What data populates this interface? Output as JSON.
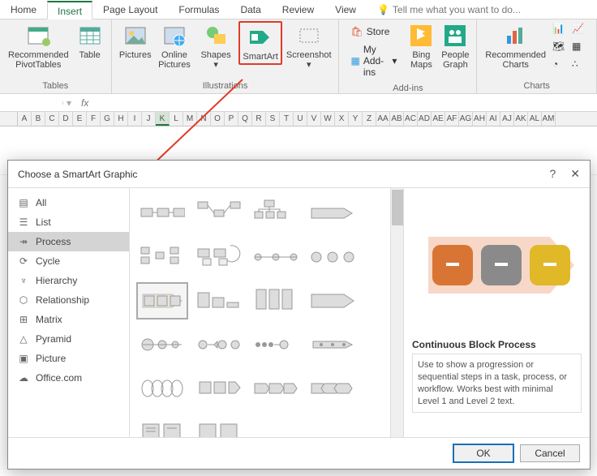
{
  "tabs": {
    "home": "Home",
    "insert": "Insert",
    "page_layout": "Page Layout",
    "formulas": "Formulas",
    "data": "Data",
    "review": "Review",
    "view": "View",
    "tell_me": "Tell me what you want to do..."
  },
  "ribbon": {
    "tables": {
      "label": "Tables",
      "recommended_pivot": "Recommended\nPivotTables",
      "table": "Table"
    },
    "illustrations": {
      "label": "Illustrations",
      "pictures": "Pictures",
      "online_pictures": "Online\nPictures",
      "shapes": "Shapes",
      "smartart": "SmartArt",
      "screenshot": "Screenshot"
    },
    "addins": {
      "label": "Add-ins",
      "store": "Store",
      "my_addins": "My Add-ins",
      "bing": "Bing\nMaps",
      "people": "People\nGraph"
    },
    "charts": {
      "label": "Charts",
      "recommended": "Recommended\nCharts"
    }
  },
  "columns": [
    "A",
    "B",
    "C",
    "D",
    "E",
    "F",
    "G",
    "H",
    "I",
    "J",
    "K",
    "L",
    "M",
    "N",
    "O",
    "P",
    "Q",
    "R",
    "S",
    "T",
    "U",
    "V",
    "W",
    "X",
    "Y",
    "Z",
    "AA",
    "AB",
    "AC",
    "AD",
    "AE",
    "AF",
    "AG",
    "AH",
    "AI",
    "AJ",
    "AK",
    "AL",
    "AM"
  ],
  "selected_col": "K",
  "dialog": {
    "title": "Choose a SmartArt Graphic",
    "categories": [
      {
        "icon": "all",
        "label": "All"
      },
      {
        "icon": "list",
        "label": "List"
      },
      {
        "icon": "process",
        "label": "Process",
        "selected": true
      },
      {
        "icon": "cycle",
        "label": "Cycle"
      },
      {
        "icon": "hierarchy",
        "label": "Hierarchy"
      },
      {
        "icon": "relationship",
        "label": "Relationship"
      },
      {
        "icon": "matrix",
        "label": "Matrix"
      },
      {
        "icon": "pyramid",
        "label": "Pyramid"
      },
      {
        "icon": "picture",
        "label": "Picture"
      },
      {
        "icon": "office",
        "label": "Office.com"
      }
    ],
    "preview": {
      "title": "Continuous Block Process",
      "desc": "Use to show a progression or sequential steps in a task, process, or workflow. Works best with minimal Level 1 and Level 2 text."
    },
    "ok": "OK",
    "cancel": "Cancel"
  }
}
